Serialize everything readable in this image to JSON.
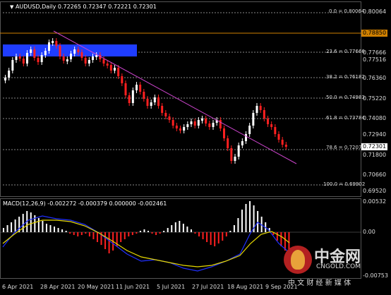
{
  "chart": {
    "symbol_title": "AUDUSD,Daily",
    "ohlc": "0.72265 0.72347 0.72221 0.72301",
    "current_price": "0.72301",
    "highlight_price": "0.78850",
    "price_scale": [
      "0.80064",
      "0.78850",
      "0.77666",
      "0.77516",
      "0.76360",
      "0.75220",
      "0.74080",
      "0.72940",
      "0.71800",
      "0.70660",
      "0.69520"
    ],
    "fibonacci": [
      {
        "label": "0.0 = 0.80064"
      },
      {
        "label": "23.6 = 0.77666"
      },
      {
        "label": "38.2 = 0.76182"
      },
      {
        "label": "50.0 = 0.74983"
      },
      {
        "label": "61.8 = 0.73784"
      },
      {
        "label": "78.6 = 0.72077"
      },
      {
        "label": "100.0 = 0.69902"
      }
    ],
    "colors": {
      "bull": "#ffffff",
      "bear": "#ff2020",
      "trendline": "#cc44cc",
      "zone": "#1f3dff",
      "highlight": "#d08000"
    }
  },
  "macd": {
    "title": "MACD(12,26,9) -0.002272 -0.000379 0.000000 -0.002461",
    "scale": [
      "0.00532",
      "0.00",
      "-0.00753"
    ],
    "colors": {
      "histogram_pos": "#ffffff",
      "histogram_neg": "#ff2020",
      "macd_line": "#2030ff",
      "signal_line": "#e6d800"
    }
  },
  "dates": [
    "6 Apr 2021",
    "28 Apr 2021",
    "20 May 2021",
    "11 Jun 2021",
    "5 Jul 2021",
    "27 Jul 2021",
    "18 Aug 2021",
    "9 Sep 2021"
  ],
  "watermark": {
    "brand": "中金网",
    "url": "CNGOLD.COM",
    "slogan": "中 文 财 经 新 媒 体"
  }
}
